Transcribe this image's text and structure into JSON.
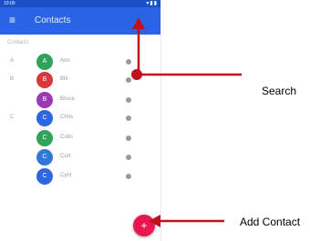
{
  "statusbar": {
    "time": "10:00",
    "icons": "▾▮▮"
  },
  "appbar": {
    "menu_glyph": "≡",
    "title": "Contacts"
  },
  "section_label": "Contacts",
  "contacts": [
    {
      "letter": "A",
      "initial": "A",
      "name": "Ann",
      "color": "#2fa35a"
    },
    {
      "letter": "B",
      "initial": "B",
      "name": "Bill",
      "color": "#d9383a"
    },
    {
      "letter": "",
      "initial": "B",
      "name": "Bruce",
      "color": "#9c38b5"
    },
    {
      "letter": "C",
      "initial": "C",
      "name": "Chris",
      "color": "#2d66e0"
    },
    {
      "letter": "",
      "initial": "C",
      "name": "Colin",
      "color": "#2fa35a"
    },
    {
      "letter": "",
      "initial": "C",
      "name": "Curt",
      "color": "#2f78d8"
    },
    {
      "letter": "",
      "initial": "C",
      "name": "Cyril",
      "color": "#2d66e0"
    }
  ],
  "fab": {
    "glyph": "+",
    "color": "#e8174f"
  },
  "callouts": {
    "search": "Search",
    "add_contact": "Add Contact"
  },
  "colors": {
    "appbar": "#2a63e3",
    "arrow": "#c0111f"
  }
}
